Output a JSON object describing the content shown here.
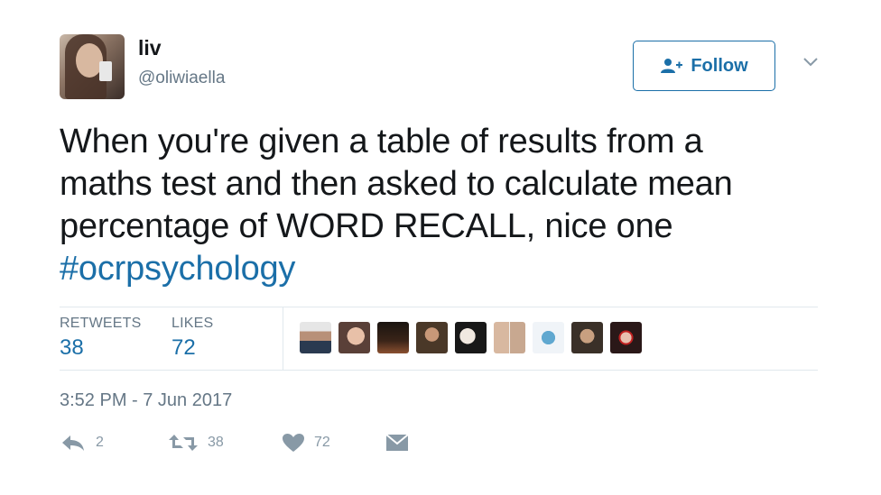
{
  "user": {
    "display_name": "liv",
    "handle": "@oliwiaella"
  },
  "follow_button": {
    "label": "Follow"
  },
  "tweet": {
    "lines": [
      "When you're given a table of results from a",
      "maths test and then asked to calculate mean",
      "percentage of WORD RECALL, nice one"
    ],
    "hashtag": "#ocrpsychology"
  },
  "stats": {
    "retweets_label": "RETWEETS",
    "retweets_value": "38",
    "likes_label": "LIKES",
    "likes_value": "72"
  },
  "timestamp": "3:52 PM - 7 Jun 2017",
  "actions": {
    "reply_count": "2",
    "retweet_count": "38",
    "like_count": "72"
  },
  "colors": {
    "accent": "#1b6fa8",
    "muted": "#657786",
    "icon": "#8899a6"
  },
  "icons": {
    "follow": "person-add-icon",
    "more": "chevron-down-icon",
    "reply": "reply-icon",
    "retweet": "retweet-icon",
    "like": "heart-icon",
    "dm": "direct-message-icon"
  }
}
